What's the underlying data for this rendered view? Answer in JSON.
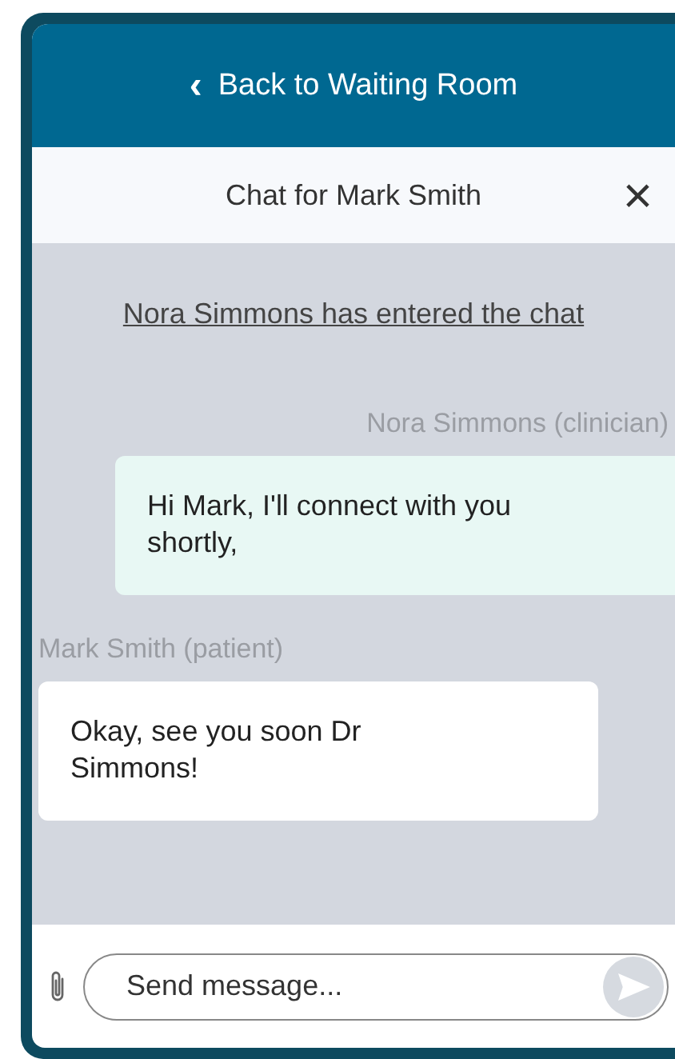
{
  "header": {
    "back_icon": "‹",
    "back_label": "Back to Waiting Room"
  },
  "chat_header": {
    "title": "Chat for Mark Smith",
    "close": "×"
  },
  "messages": [
    {
      "kind": "system",
      "text": "Nora Simmons has entered the chat"
    },
    {
      "kind": "clinician",
      "sender": "Nora Simmons (clinician)",
      "text": "Hi Mark, I'll connect with you shortly,"
    },
    {
      "kind": "patient",
      "sender": "Mark Smith (patient)",
      "text": "Okay, see you soon Dr Simmons!"
    }
  ],
  "composer": {
    "placeholder": "Send message..."
  }
}
